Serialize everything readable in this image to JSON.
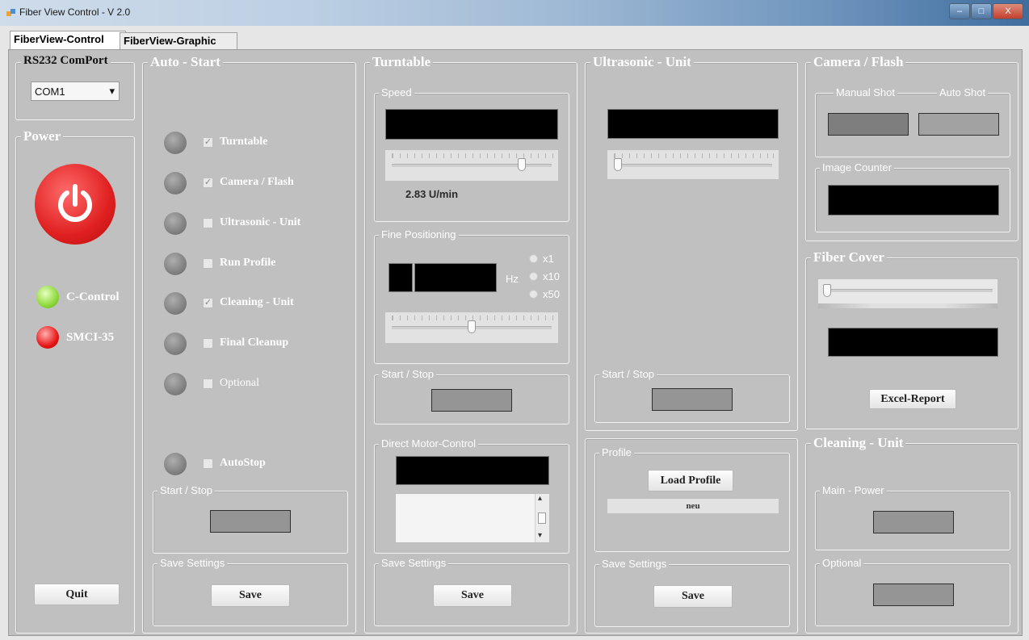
{
  "window": {
    "title": "Fiber View Control - V 2.0",
    "min": "–",
    "max": "□",
    "close": "X"
  },
  "tabs": [
    "FiberView-Control",
    "FiberView-Graphic"
  ],
  "comport": {
    "title": "RS232 ComPort",
    "value": "COM1",
    "arrow": "▾"
  },
  "power": {
    "title": "Power",
    "indicators": [
      "C-Control",
      "SMCI-35"
    ],
    "indicator_colors": [
      "#8ed93a",
      "#e81818"
    ],
    "quit": "Quit",
    "icon": "power-icon"
  },
  "autostart": {
    "title": "Auto - Start",
    "items": [
      {
        "label": "Turntable",
        "checked": true
      },
      {
        "label": "Camera / Flash",
        "checked": true
      },
      {
        "label": "Ultrasonic - Unit",
        "checked": false
      },
      {
        "label": "Run Profile",
        "checked": false
      },
      {
        "label": "Cleaning - Unit",
        "checked": true
      },
      {
        "label": "Final Cleanup",
        "checked": false
      },
      {
        "label": "Optional",
        "checked": false
      },
      {
        "label": "AutoStop",
        "checked": false
      }
    ],
    "start_stop": "Start / Stop",
    "save_settings": "Save Settings",
    "save": "Save"
  },
  "turntable": {
    "title": "Turntable",
    "speed_label": "Speed",
    "speed_value": "2.83  U/min",
    "speed_slider": 0.83,
    "fine_label": "Fine Positioning",
    "hz": "Hz",
    "multipliers": [
      "x1",
      "x10",
      "x50"
    ],
    "fine_slider": 0.5,
    "start_stop": "Start / Stop",
    "direct_label": "Direct Motor-Control",
    "scroll_up": "▴",
    "scroll_down": "▾",
    "save_settings": "Save Settings",
    "save": "Save"
  },
  "ultrasonic": {
    "title": "Ultrasonic - Unit",
    "slider": 0.0,
    "start_stop": "Start / Stop",
    "profile_label": "Profile",
    "load_profile": "Load Profile",
    "profile_name": "neu",
    "save_settings": "Save Settings",
    "save": "Save"
  },
  "camera": {
    "title": "Camera / Flash",
    "manual_shot": "Manual Shot",
    "auto_shot": "Auto Shot",
    "image_counter": "Image Counter"
  },
  "fibercover": {
    "title": "Fiber Cover",
    "slider": 0.0,
    "excel_report": "Excel-Report"
  },
  "cleaning": {
    "title": "Cleaning - Unit",
    "main_power": "Main - Power",
    "optional": "Optional"
  }
}
